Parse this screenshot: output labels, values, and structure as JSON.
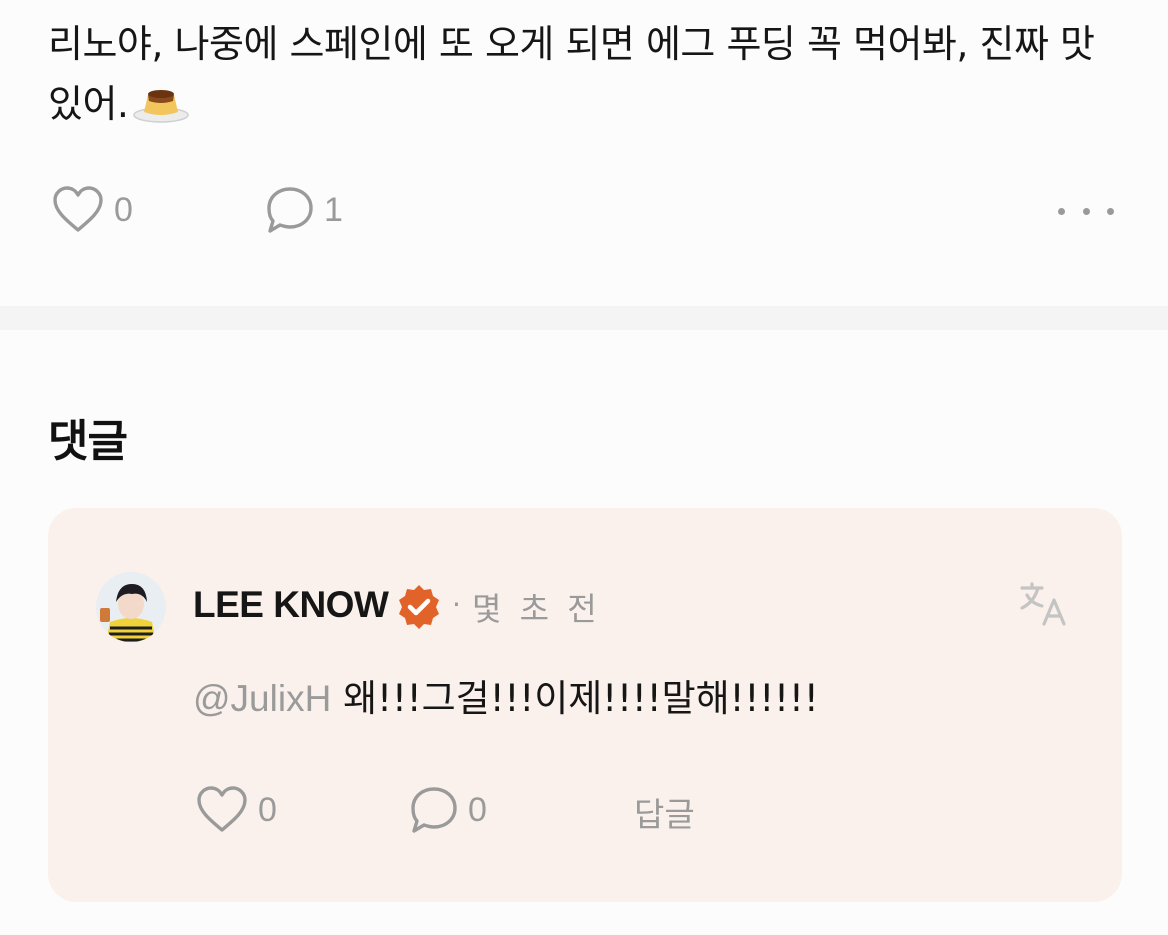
{
  "post": {
    "text": "리노야, 나중에 스페인에 또 오게 되면 에그 푸딩 꼭 먹어봐, 진짜 맛있어.",
    "emoji_icon": "custard-pudding-icon",
    "like_count": "0",
    "comment_count": "1"
  },
  "comments_section": {
    "title": "댓글"
  },
  "comment": {
    "author": "LEE KNOW",
    "verified_icon": "verified-badge-icon",
    "separator": "·",
    "time": "몇 초 전",
    "mention": "@JulixH",
    "text": " 왜!!!그걸!!!이제!!!!말해!!!!!!",
    "like_count": "0",
    "reply_count": "0",
    "reply_label": "답글"
  },
  "colors": {
    "background": "#fdfcfc",
    "card": "#fbf1ec",
    "muted": "#9a9a9a",
    "badge": "#e2632a",
    "divider": "#f4f4f4"
  }
}
